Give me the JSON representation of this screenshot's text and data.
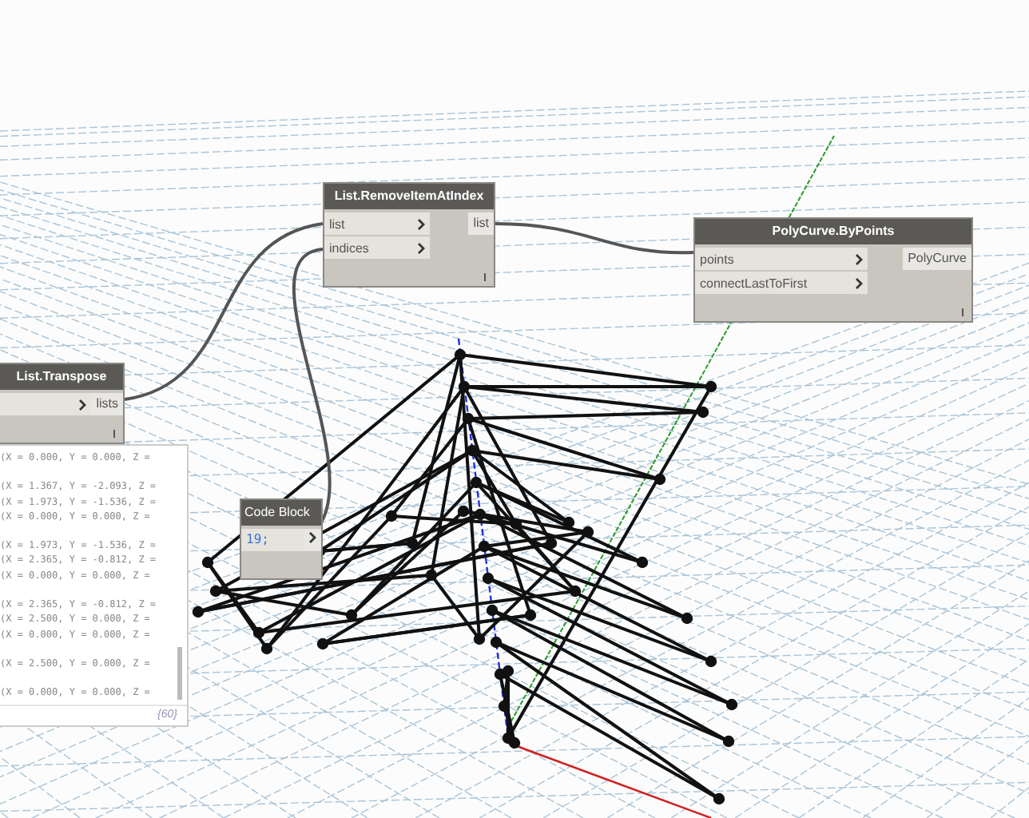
{
  "nodes": [
    {
      "kind": "function",
      "title": "List.RemoveItemAtIndex",
      "inputs": [
        {
          "kind": "labeled",
          "label": "list"
        },
        {
          "kind": "labeled",
          "label": "indices"
        }
      ],
      "outputs": [
        "list"
      ]
    },
    {
      "kind": "function",
      "title": "PolyCurve.ByPoints",
      "inputs": [
        {
          "kind": "labeled",
          "label": "points"
        },
        {
          "kind": "labeled",
          "label": "connectLastToFirst"
        }
      ],
      "outputs": [
        "PolyCurve"
      ]
    },
    {
      "kind": "function",
      "title": "List.Transpose",
      "inputs": [
        {
          "kind": "bare"
        }
      ],
      "outputs": [
        "lists"
      ],
      "preview": {
        "groups": [
          [
            "(X = 0.000, Y = 0.000, Z ="
          ],
          [
            "(X = 1.367, Y = -2.093, Z =",
            "(X = 1.973, Y = -1.536, Z =",
            "(X = 0.000, Y = 0.000, Z ="
          ],
          [
            "(X = 1.973, Y = -1.536, Z =",
            "(X = 2.365, Y = -0.812, Z =",
            "(X = 0.000, Y = 0.000, Z ="
          ],
          [
            "(X = 2.365, Y = -0.812, Z =",
            "(X = 2.500, Y = 0.000, Z =",
            "(X = 0.000, Y = 0.000, Z ="
          ],
          [
            "(X = 2.500, Y = 0.000, Z ="
          ],
          [
            "(X = 0.000, Y = 0.000, Z ="
          ]
        ],
        "count": "{60}"
      }
    },
    {
      "kind": "code",
      "title": "Code Block",
      "value": "19;"
    }
  ]
}
